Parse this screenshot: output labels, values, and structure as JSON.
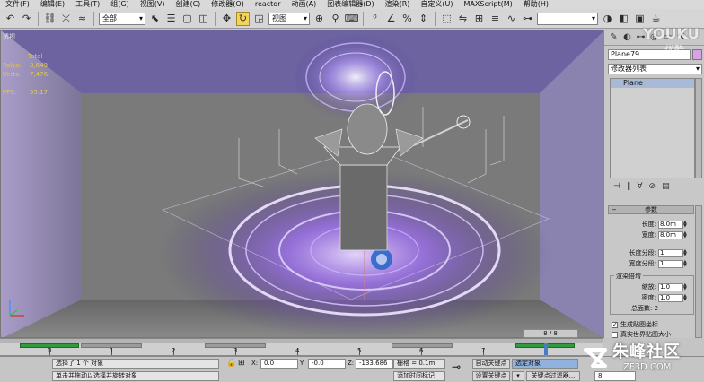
{
  "menu": [
    "文件(F)",
    "编辑(E)",
    "工具(T)",
    "组(G)",
    "视图(V)",
    "创建(C)",
    "修改器(O)",
    "reactor",
    "动画(A)",
    "图表编辑器(D)",
    "渲染(R)",
    "自定义(U)",
    "MAXScript(M)",
    "帮助(H)"
  ],
  "toolbar": {
    "selection_filter": "全部",
    "reference_coord": "视图",
    "named_selection": "",
    "active_tool_icon": "rotate-icon"
  },
  "viewport": {
    "label": "透视",
    "stats": {
      "header": "Total",
      "polys_label": "Polys:",
      "polys_value": "3,649",
      "verts_label": "Verts:",
      "verts_value": "7,476",
      "fps_label": "FPS:",
      "fps_value": "55.17"
    }
  },
  "command_panel": {
    "object_name": "Plane79",
    "object_color": "#d8a2e4",
    "modifier_list": "修改器列表",
    "stack_items": [
      "Plane"
    ],
    "rollout_title": "参数",
    "length_label": "长度:",
    "length_value": "8.0m",
    "width_label": "宽度:",
    "width_value": "8.0m",
    "length_segs_label": "长度分段:",
    "length_segs_value": "1",
    "width_segs_label": "宽度分段:",
    "width_segs_value": "1",
    "render_mult_title": "渲染倍增",
    "scale_label": "缩放:",
    "scale_value": "1.0",
    "density_label": "密度:",
    "density_value": "1.0",
    "total_faces": "总面数: 2",
    "gen_mapping_label": "生成贴图坐标",
    "gen_mapping_checked": true,
    "real_world_label": "真实世界贴图大小",
    "real_world_checked": false
  },
  "timeline": {
    "frame_counter": "8 / 8",
    "ticks": [
      "0",
      "1",
      "2",
      "3",
      "4",
      "5",
      "6",
      "7"
    ]
  },
  "status": {
    "selection": "选择了 1 个 对象",
    "prompt": "单击并拖动以选择并旋转对象",
    "x_label": "X:",
    "x_value": "0.0",
    "y_label": "Y:",
    "y_value": "-0.0",
    "z_label": "Z:",
    "z_value": "-133.686",
    "grid": "栅格 = 0.1m",
    "add_time_tag": "添加时间标记",
    "auto_key": "自动关键点",
    "set_key": "设置关键点",
    "selected_objects": "选定对象",
    "key_filters": "关键点过滤器...",
    "frame_value": "8"
  },
  "watermarks": {
    "youku": "YOUKU",
    "youku_cn": "优酷",
    "zf_cn": "朱峰社区",
    "zf_url": "ZF3D.COM"
  }
}
